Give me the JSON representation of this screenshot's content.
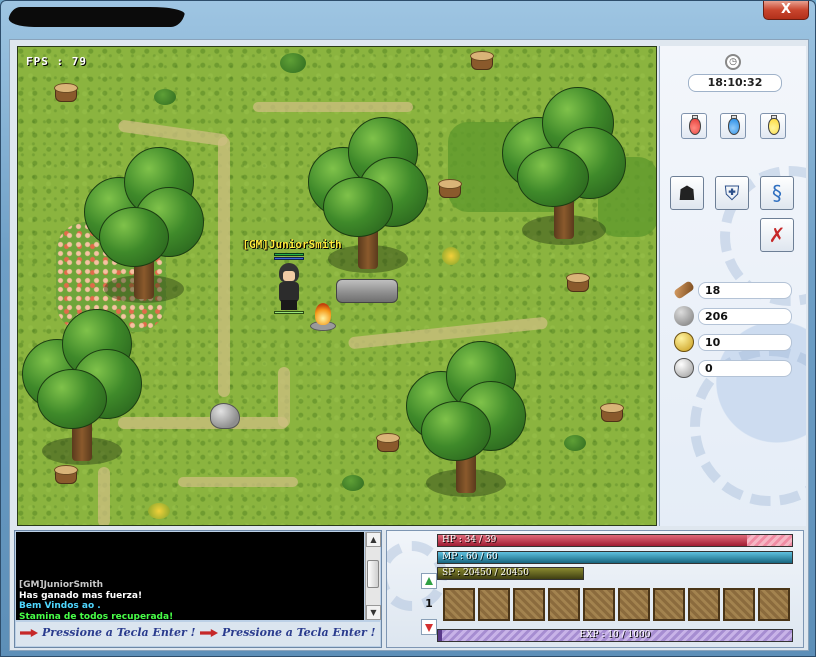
{
  "window": {
    "close_label": "X"
  },
  "game": {
    "fps_label": "FPS : 79",
    "player_name": "[GM]JuniorSmith"
  },
  "side_panel": {
    "time": "18:10:32",
    "potions": [
      {
        "icon": "red-potion-icon",
        "color": "#e53935"
      },
      {
        "icon": "blue-potion-icon",
        "color": "#1e88e5"
      },
      {
        "icon": "yellow-potion-icon",
        "color": "#fdd835"
      }
    ],
    "resources": [
      {
        "icon": "wood-log-icon",
        "value": "18"
      },
      {
        "icon": "stone-ore-icon",
        "value": "206"
      },
      {
        "icon": "gold-coins-icon",
        "value": "10"
      },
      {
        "icon": "silver-coins-icon",
        "value": "0"
      }
    ]
  },
  "chat": {
    "lines": [
      {
        "text": "[GM]JuniorSmith",
        "color": "#c8c8c8"
      },
      {
        "text": "Has ganado mas fuerza!",
        "color": "#ffffff"
      },
      {
        "text": " Bem Vindos ao .",
        "color": "#4fd7ff"
      },
      {
        "text": "Stamina de todos recuperada!",
        "color": "#48ff48"
      }
    ],
    "prompt_1": "Pressione a Tecla Enter !",
    "prompt_2": "Pressione a Tecla Enter !"
  },
  "status": {
    "hp_label": "HP : 34 / 39",
    "hp_current": 34,
    "hp_max": 39,
    "mp_label": "MP : 60 / 60",
    "mp_current": 60,
    "mp_max": 60,
    "sp_label": "SP : 20450 / 20450",
    "sp_current": 20450,
    "sp_max": 20450,
    "exp_label": "EXP : 10 / 1000",
    "exp_current": 10,
    "exp_max": 1000,
    "hotbar_page": "1",
    "hotbar_slot_count": 10
  }
}
